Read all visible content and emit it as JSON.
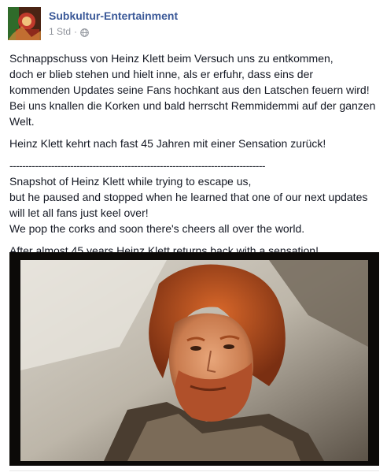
{
  "post": {
    "page_name": "Subkultur-Entertainment",
    "timestamp": "1 Std",
    "separator": "·",
    "audience_icon": "globe-icon",
    "paragraphs": [
      {
        "lines": [
          "Schnappschuss von Heinz Klett beim Versuch uns zu entkommen,",
          "doch er blieb stehen und hielt inne, als er erfuhr, dass eins der",
          "kommenden Updates seine Fans hochkant aus den Latschen feuern wird!",
          "Bei uns knallen die Korken und bald herrscht Remmidemmi auf der ganzen",
          "Welt."
        ]
      },
      {
        "lines": [
          "Heinz Klett kehrt nach fast 45 Jahren mit einer Sensation zurück!"
        ]
      },
      {
        "lines": [
          "--------------------------------------------------------------------------------",
          "Snapshot of Heinz Klett while trying to escape us,",
          "but he paused and stopped when he learned that one of our next updates",
          "will let all fans just keel over!",
          "We pop the corks and soon there's cheers all over the world."
        ]
      },
      {
        "lines": [
          "After almost 45 years Heinz Klett returns back with a sensation!"
        ]
      }
    ]
  },
  "colors": {
    "link": "#3b5998",
    "text": "#141823",
    "meta": "#90949c"
  }
}
